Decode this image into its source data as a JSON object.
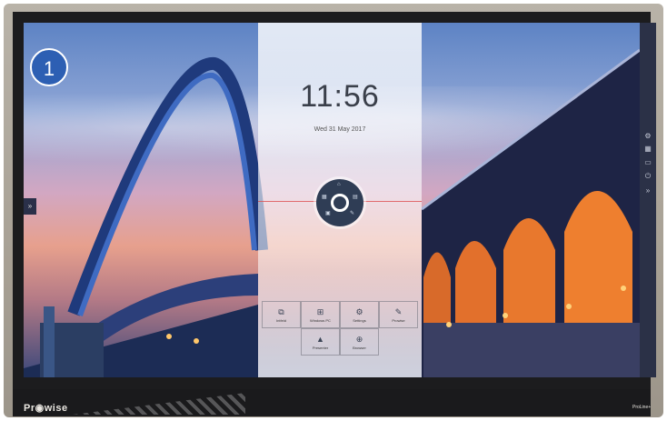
{
  "badge": {
    "number": "1"
  },
  "brand": {
    "logo_text": "Pr◉wise",
    "model": "ProLine+"
  },
  "clock": {
    "time": "11:56",
    "date": "Wed 31 May 2017"
  },
  "tiles": [
    {
      "icon": "whiteboard-icon",
      "label": "Intfeld"
    },
    {
      "icon": "windows-pc-icon",
      "label": "Windows PC"
    },
    {
      "icon": "settings-icon",
      "label": "Settings"
    },
    {
      "icon": "annotate-icon",
      "label": "Prowise"
    },
    {
      "icon": "presenter-icon",
      "label": "Presenter"
    },
    {
      "icon": "browser-icon",
      "label": "Browser"
    }
  ],
  "sidebar_icons": [
    "gear-icon",
    "grid-icon",
    "display-icon",
    "power-icon",
    "expand-icon"
  ],
  "left_tab": {
    "icon": "chevron-right-icon",
    "glyph": "»"
  }
}
